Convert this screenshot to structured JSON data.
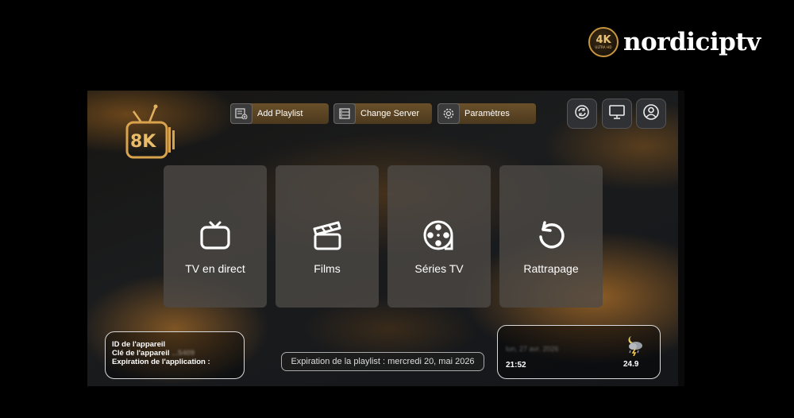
{
  "brand": {
    "seal_text": "4K",
    "seal_subtext": "ULTRA HD",
    "name": "nordiciptv"
  },
  "app": {
    "logo_text": "8K"
  },
  "toolbar": {
    "add_playlist": "Add Playlist",
    "change_server": "Change Server",
    "settings": "Paramètres",
    "right_icons": [
      "refresh-icon",
      "monitor-icon",
      "user-icon"
    ]
  },
  "tiles": [
    {
      "label": "TV en direct",
      "icon": "tv-icon"
    },
    {
      "label": "Films",
      "icon": "clapperboard-icon"
    },
    {
      "label": "Séries TV",
      "icon": "film-reel-icon"
    },
    {
      "label": "Rattrapage",
      "icon": "replay-icon"
    }
  ],
  "device": {
    "id_label": "ID de l'appareil",
    "key_label": "Clé de l'appareil",
    "key_value": "...5409",
    "expiration_label": "Expiration de l'application :"
  },
  "playlist": {
    "expiration": "Expiration de la playlist : mercredi 20, mai 2026"
  },
  "weather": {
    "date": "lun, 27 avr. 2026",
    "time": "21:52",
    "temperature": "24.9",
    "condition_icon": "thunderstorm-night-icon"
  },
  "colors": {
    "accent": "#c8953f",
    "tile": "#4e4a46",
    "background": "#000000"
  }
}
